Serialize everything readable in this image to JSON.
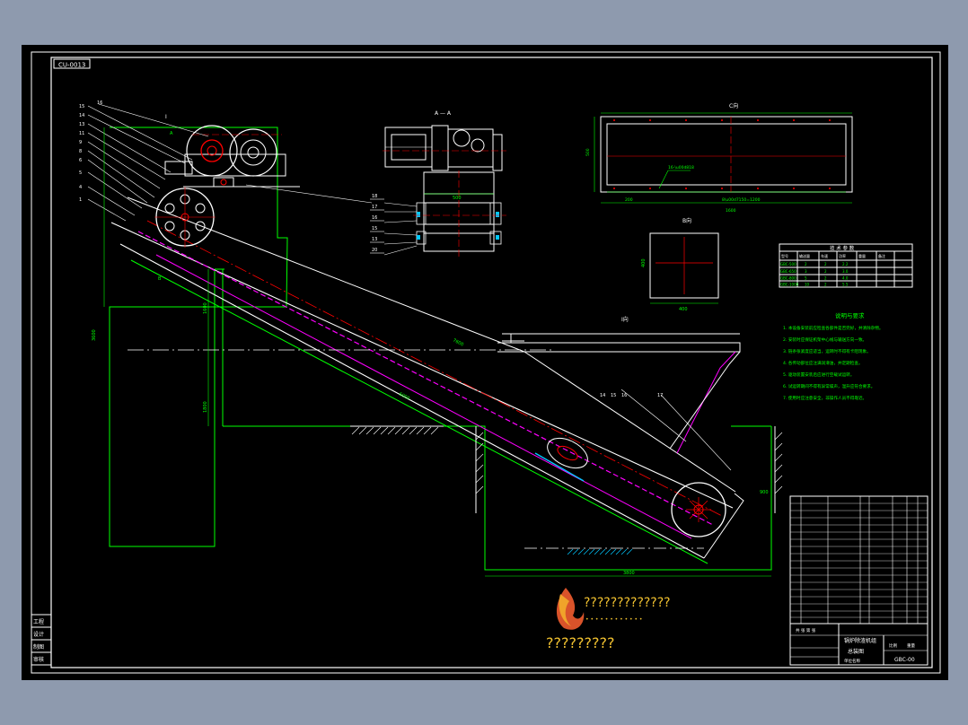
{
  "drawing": {
    "drawing_code": "CU-0013",
    "left_margin_labels": [
      "工程",
      "设计",
      "制图",
      "审核"
    ],
    "view_labels": {
      "section_a": "A — A",
      "view_c": "C向",
      "view_b": "B向",
      "view_i": "I向"
    },
    "notes_title": "说明与要求",
    "notes": [
      "1. 本设备安装前应检查各部件是否完好，并清除杂物。",
      "2. 安装时应保证机架中心线与输送方向一致。",
      "3. 链条张紧度应适当，运转时不得有卡阻现象。",
      "4. 各传动部位应注满润滑油，并定期检查。",
      "5. 驱动装置安装后应进行空载试运转。",
      "6. 试运转期间不得有异常噪声，温升应符合要求。",
      "7. 使用时应注意安全，非操作人员不得靠近。"
    ],
    "tech_table": {
      "title": "技 术 参 数",
      "headers": [
        "型号",
        "输送量",
        "车速",
        "功率",
        "重量",
        "备注"
      ],
      "rows": [
        [
          "GBC-500",
          "2",
          "2",
          "2.2",
          "",
          ""
        ],
        [
          "GBC-650",
          "3",
          "2",
          "3.0",
          "",
          ""
        ],
        [
          "GBC-800",
          "5",
          "2",
          "4.0",
          "",
          ""
        ],
        [
          "GBC-1000",
          "10",
          "2",
          "5.5",
          "",
          ""
        ]
      ]
    },
    "title_block": {
      "title_line1": "锅炉除渣机组",
      "title_line2": "总装图",
      "drawing_no": "GBC-00",
      "scale_label": "比例",
      "weight_label": "重量",
      "company": "单位名称",
      "sheet_label": "共 张 第 张"
    },
    "watermark": {
      "line1": "?????????????",
      "line2": "?????????",
      "dots": "• • • • • • • • • • • •"
    },
    "colors": {
      "border": "#ffffff",
      "outline": "#00ff00",
      "centerline": "#ff0000",
      "chain": "#ff00ff",
      "water_fill": "#00c8ff",
      "background": "#000000",
      "window": "#8e9aae"
    }
  }
}
